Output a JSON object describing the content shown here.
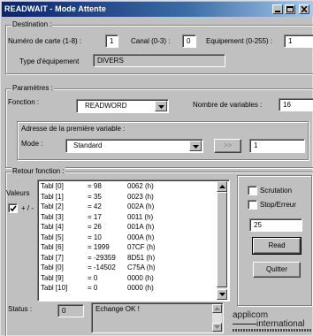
{
  "window": {
    "title": "READWAIT - Mode Attente"
  },
  "destination": {
    "group_label": "Destination :",
    "card_label": "Numéro de carte (1-8) :",
    "card_value": "1",
    "channel_label": "Canal (0-3) :",
    "channel_value": "0",
    "equipment_label": "Equipement (0-255) :",
    "equipment_value": "1",
    "type_label": "Type d'équipement",
    "type_value": "DIVERS"
  },
  "parameters": {
    "group_label": "Paramètres :",
    "function_label": "Fonction :",
    "function_value": "READWORD",
    "nb_vars_label": "Nombre de variables :",
    "nb_vars_value": "16",
    "address_group_label": "Adresse de la première variable :",
    "mode_label": "Mode :",
    "mode_value": "Standard",
    "nav_button": ">>",
    "address_value": "1"
  },
  "results": {
    "group_label": "Retour fonction :",
    "values_label": "Valeurs",
    "sign_label": "+ / -",
    "sign_checked": true,
    "rows": [
      {
        "name": "Tabl [0]",
        "dec": "= 98",
        "hex": "0062  (h)"
      },
      {
        "name": "Tabl [1]",
        "dec": "= 35",
        "hex": "0023  (h)"
      },
      {
        "name": "Tabl [2]",
        "dec": "= 42",
        "hex": "002A  (h)"
      },
      {
        "name": "Tabl [3]",
        "dec": "= 17",
        "hex": "0011  (h)"
      },
      {
        "name": "Tabl [4]",
        "dec": "= 26",
        "hex": "001A  (h)"
      },
      {
        "name": "Tabl [5]",
        "dec": "= 10",
        "hex": "000A  (h)"
      },
      {
        "name": "Tabl [6]",
        "dec": "= 1999",
        "hex": "07CF  (h)"
      },
      {
        "name": "Tabl [7]",
        "dec": "= -29359",
        "hex": "8D51  (h)"
      },
      {
        "name": "Tabl [0]",
        "dec": "= -14502",
        "hex": "C75A  (h)"
      },
      {
        "name": "Tabl [9]",
        "dec": "= 0",
        "hex": "0000  (h)"
      },
      {
        "name": "Tabl [10]",
        "dec": "= 0",
        "hex": "0000  (h)"
      }
    ],
    "status_label": "Status :",
    "status_code": "0",
    "status_text": "Echange OK !"
  },
  "side": {
    "scrutation_label": "Scrutation",
    "scrutation_checked": false,
    "stop_label": "Stop/Erreur",
    "stop_checked": false,
    "interval_value": "25",
    "read_button": "Read",
    "quit_button": "Quitter"
  },
  "logo": {
    "line1": "applicom",
    "line2": "international"
  }
}
